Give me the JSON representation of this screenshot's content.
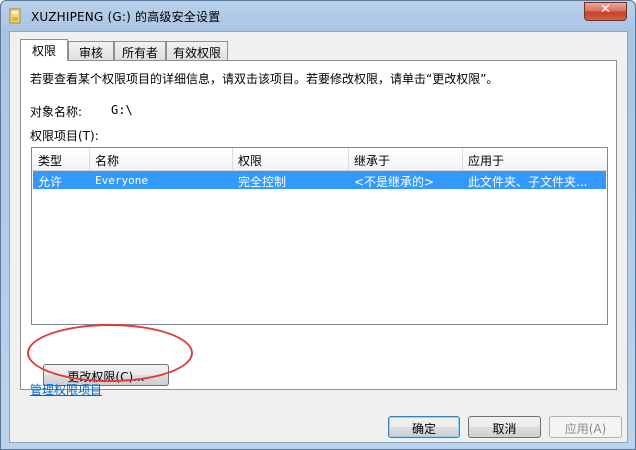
{
  "window": {
    "title": "XUZHIPENG (G:) 的高级安全设置",
    "close_label": "✕"
  },
  "tabs": [
    {
      "label": "权限",
      "active": true
    },
    {
      "label": "审核",
      "active": false
    },
    {
      "label": "所有者",
      "active": false
    },
    {
      "label": "有效权限",
      "active": false
    }
  ],
  "panel": {
    "description": "若要查看某个权限项目的详细信息，请双击该项目。若要修改权限，请单击“更改权限”。",
    "object_name_label": "对象名称:",
    "object_name_value": "G:\\",
    "entries_label": "权限项目(T):",
    "columns": [
      "类型",
      "名称",
      "权限",
      "继承于",
      "应用于"
    ],
    "rows": [
      {
        "type": "允许",
        "name": "Everyone",
        "permission": "完全控制",
        "inherited_from": "<不是继承的>",
        "applies_to": "此文件夹、子文件夹..."
      }
    ],
    "change_permissions_button": "更改权限(C)...",
    "manage_link": "管理权限项目"
  },
  "footer": {
    "ok": "确定",
    "cancel": "取消",
    "apply": "应用(A)"
  },
  "colors": {
    "selection": "#3399ff",
    "highlight_ring": "#e03a3a",
    "link": "#0066cc"
  }
}
